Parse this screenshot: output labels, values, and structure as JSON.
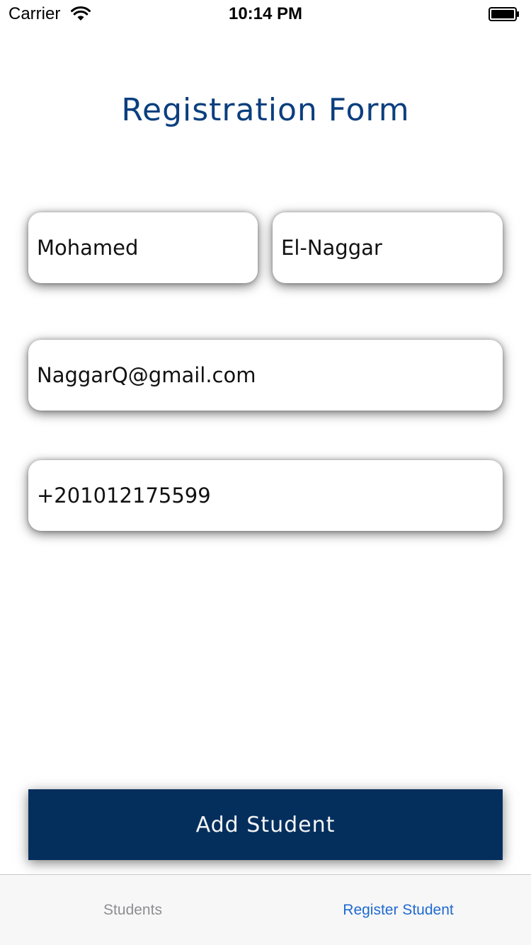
{
  "status_bar": {
    "carrier": "Carrier",
    "time": "10:14 PM",
    "icons": [
      "wifi-icon",
      "battery-icon"
    ]
  },
  "form": {
    "title": "Registration Form",
    "first_name": "Mohamed",
    "last_name": "El-Naggar",
    "email": "NaggarQ@gmail.com",
    "phone": "+201012175599",
    "submit_label": "Add Student"
  },
  "tab_bar": {
    "tabs": [
      {
        "label": "Students",
        "selected": false
      },
      {
        "label": "Register Student",
        "selected": true
      }
    ]
  },
  "colors": {
    "title": "#0b3f7e",
    "button_bg": "#042f5d",
    "tab_active": "#1f6ad1",
    "tab_inactive": "#8e8e93"
  }
}
